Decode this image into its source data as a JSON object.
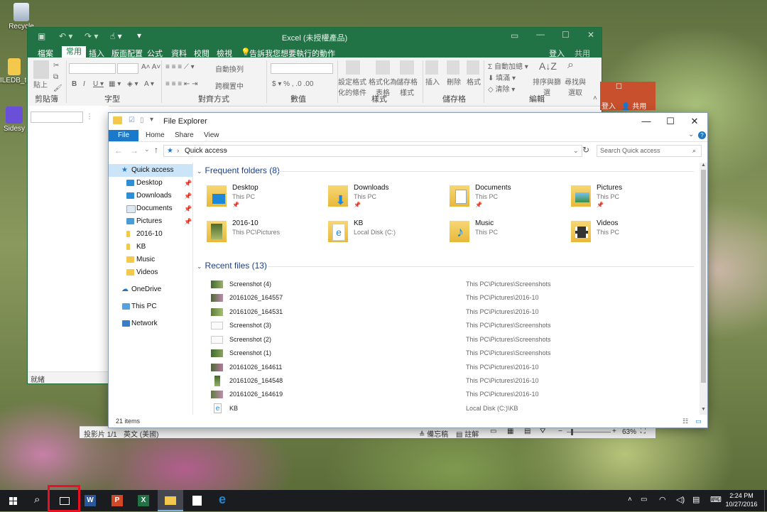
{
  "desktop": {
    "icons": [
      {
        "label": "Recycle"
      },
      {
        "label": "ILEDB_te"
      },
      {
        "label": "Sidesy"
      }
    ]
  },
  "excel": {
    "title": "Excel (未授權產品)",
    "tabs": [
      "檔案",
      "常用",
      "插入",
      "版面配置",
      "公式",
      "資料",
      "校閱",
      "檢視"
    ],
    "tell_me": "告訴我您想要執行的動作",
    "signin": "登入",
    "share": "共用",
    "groups": [
      "剪貼簿",
      "字型",
      "對齊方式",
      "數值",
      "樣式",
      "儲存格",
      "編輯"
    ],
    "ribbon_labels": {
      "paste": "貼上",
      "wrap": "自動換列",
      "merge": "跨欄置中",
      "conditional": "設定格式化的條件",
      "format_table": "格式化為表格",
      "cell_styles": "儲存格樣式",
      "insert": "插入",
      "delete": "刪除",
      "format": "格式",
      "autosum": "自動加總",
      "fill": "填滿",
      "clear": "清除",
      "sort": "排序與篩選",
      "find": "尋找與選取"
    },
    "status": "就緒"
  },
  "ppt_edge": {
    "signin": "登入",
    "share": "共用"
  },
  "ppt_status": {
    "slide": "投影片 1/1",
    "lang": "英文 (美國)",
    "notes": "備忘稿",
    "comments": "註解",
    "zoom": "63%"
  },
  "explorer": {
    "title": "File Explorer",
    "tabs": {
      "file": "File",
      "home": "Home",
      "share": "Share",
      "view": "View"
    },
    "address": "Quick access",
    "search_placeholder": "Search Quick access",
    "nav": [
      {
        "label": "Quick access",
        "pinned": false
      },
      {
        "label": "Desktop",
        "pinned": true
      },
      {
        "label": "Downloads",
        "pinned": true
      },
      {
        "label": "Documents",
        "pinned": true
      },
      {
        "label": "Pictures",
        "pinned": true
      },
      {
        "label": "2016-10",
        "pinned": false
      },
      {
        "label": "KB",
        "pinned": false
      },
      {
        "label": "Music",
        "pinned": false
      },
      {
        "label": "Videos",
        "pinned": false
      },
      {
        "label": "OneDrive",
        "pinned": false
      },
      {
        "label": "This PC",
        "pinned": false
      },
      {
        "label": "Network",
        "pinned": false
      }
    ],
    "frequent_header": "Frequent folders (8)",
    "frequent": [
      {
        "name": "Desktop",
        "sub": "This PC",
        "pinned": true
      },
      {
        "name": "Downloads",
        "sub": "This PC",
        "pinned": true
      },
      {
        "name": "Documents",
        "sub": "This PC",
        "pinned": true
      },
      {
        "name": "Pictures",
        "sub": "This PC",
        "pinned": true
      },
      {
        "name": "2016-10",
        "sub": "This PC\\Pictures",
        "pinned": false
      },
      {
        "name": "KB",
        "sub": "Local Disk (C:)",
        "pinned": false
      },
      {
        "name": "Music",
        "sub": "This PC",
        "pinned": false
      },
      {
        "name": "Videos",
        "sub": "This PC",
        "pinned": false
      }
    ],
    "recent_header": "Recent files (13)",
    "recent": [
      {
        "name": "Screenshot (4)",
        "location": "This PC\\Pictures\\Screenshots"
      },
      {
        "name": "20161026_164557",
        "location": "This PC\\Pictures\\2016-10"
      },
      {
        "name": "20161026_164531",
        "location": "This PC\\Pictures\\2016-10"
      },
      {
        "name": "Screenshot (3)",
        "location": "This PC\\Pictures\\Screenshots"
      },
      {
        "name": "Screenshot (2)",
        "location": "This PC\\Pictures\\Screenshots"
      },
      {
        "name": "Screenshot (1)",
        "location": "This PC\\Pictures\\Screenshots"
      },
      {
        "name": "20161026_164611",
        "location": "This PC\\Pictures\\2016-10"
      },
      {
        "name": "20161026_164548",
        "location": "This PC\\Pictures\\2016-10"
      },
      {
        "name": "20161026_164619",
        "location": "This PC\\Pictures\\2016-10"
      },
      {
        "name": "KB",
        "location": "Local Disk (C:)\\KB"
      }
    ],
    "status": "21 items"
  },
  "taskbar": {
    "time": "2:24 PM",
    "date": "10/27/2016",
    "highlight_color": "#e81123"
  }
}
